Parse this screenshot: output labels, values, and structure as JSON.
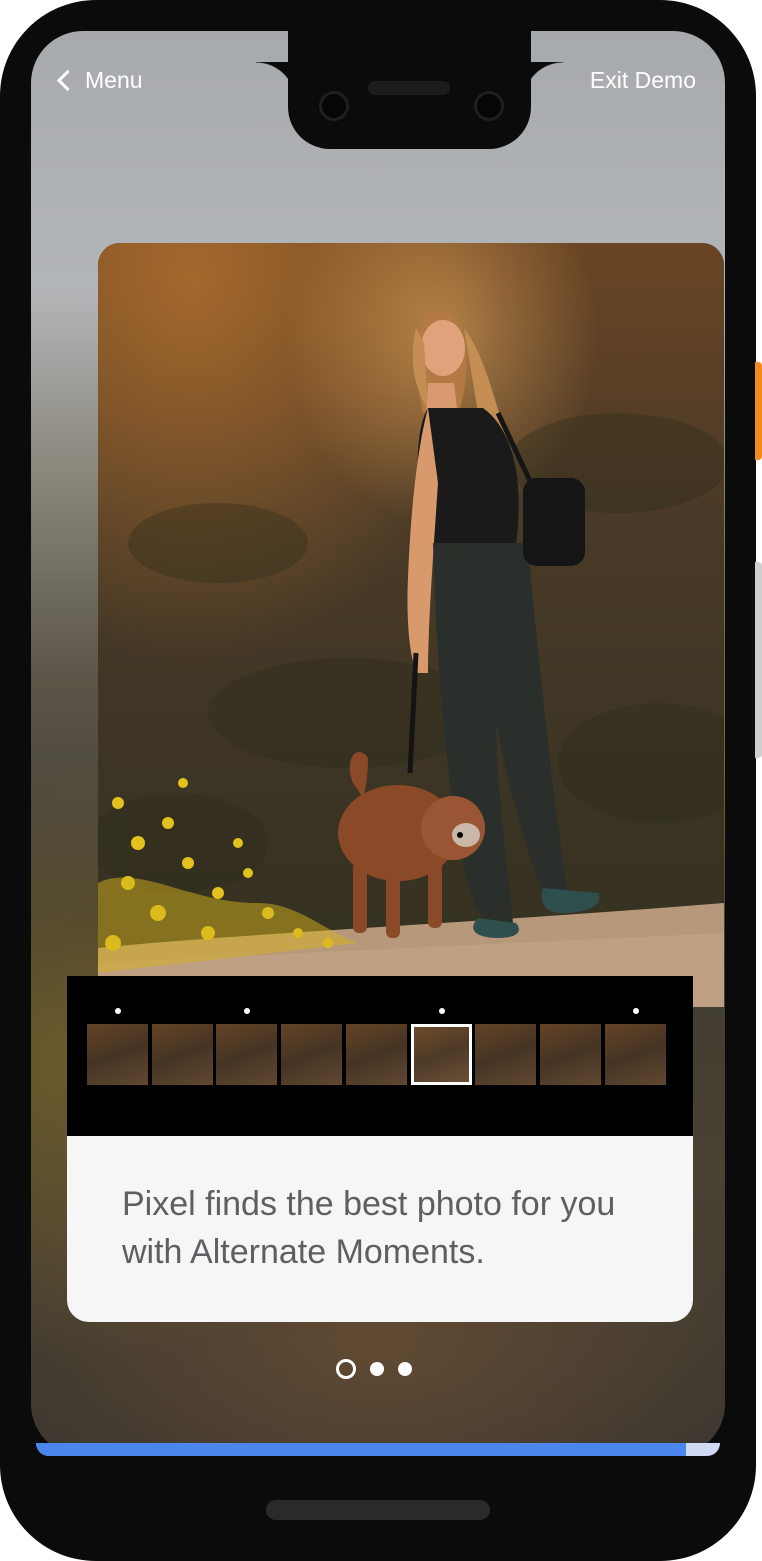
{
  "nav": {
    "back_label": "Menu",
    "exit_label": "Exit Demo"
  },
  "photo": {
    "subject": "Woman walking a dog on a hillside trail at sunset"
  },
  "filmstrip": {
    "frame_count": 9,
    "selected_index": 5,
    "marked_frames": [
      0,
      2,
      5,
      8
    ]
  },
  "caption": {
    "text": "Pixel finds the best photo for you with Alternate Moments."
  },
  "pager": {
    "total": 3,
    "current": 0
  },
  "progress": {
    "fraction": 0.95,
    "fill_color": "#4b86ec",
    "track_color": "#cfd9f2"
  },
  "colors": {
    "side_button_accent": "#f08a1c"
  },
  "icons": [
    "chevron-left-icon"
  ]
}
